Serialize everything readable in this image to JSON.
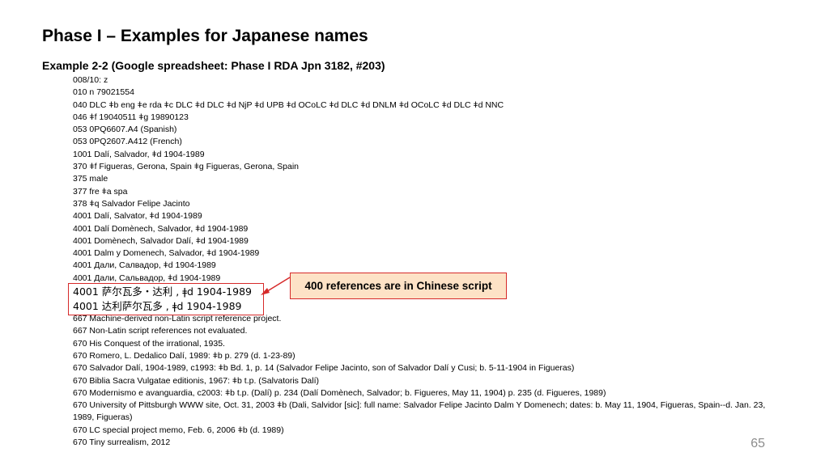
{
  "slide": {
    "title": "Phase I – Examples for Japanese names",
    "subtitle": "Example 2-2 (Google spreadsheet: Phase I RDA Jpn 3182, #203)",
    "page_number": "65"
  },
  "record": {
    "lines": [
      "008/10: z",
      "010  n  79021554",
      "040  DLC ǂb eng ǂe rda ǂc DLC ǂd DLC ǂd NjP ǂd UPB ǂd OCoLC ǂd DLC ǂd DNLM ǂd OCoLC ǂd DLC ǂd NNC",
      "046  ǂf 19040511 ǂg 19890123",
      "053 0PQ6607.A4 (Spanish)",
      "053 0PQ2607.A412 (French)",
      "1001 Dalí, Salvador, ǂd 1904-1989",
      "370  ǂf Figueras, Gerona, Spain ǂg Figueras, Gerona, Spain",
      "375  male",
      "377  fre ǂa spa",
      "378  ǂq Salvador Felipe Jacinto",
      "4001 Dalí, Salvator, ǂd 1904-1989",
      "4001 Dalí Domènech, Salvador, ǂd 1904-1989",
      "4001 Domènech, Salvador Dalí, ǂd 1904-1989",
      "4001 Dalm y Domenech, Salvador, ǂd 1904-1989",
      "4001 Дали, Салвадор, ǂd 1904-1989",
      "4001 Дали, Сальвадор, ǂd 1904-1989"
    ],
    "highlighted_lines": [
      "4001  萨尔瓦多・达利 , ǂd 1904-1989",
      "4001  达利萨尔瓦多 , ǂd 1904-1989"
    ],
    "lines_after": [
      "667  Machine-derived non-Latin script reference project.",
      "667  Non-Latin script references not evaluated.",
      "670  His Conquest of the irrational, 1935.",
      "670  Romero, L. Dedalico Dalí, 1989: ǂb p. 279 (d. 1-23-89)",
      "670  Salvador Dalí, 1904-1989, c1993: ǂb Bd. 1, p. 14 (Salvador Felipe Jacinto, son of Salvador Dalí y Cusi; b. 5-11-1904 in Figueras)",
      "670  Biblia Sacra Vulgatae editionis, 1967: ǂb t.p. (Salvatoris Dalí)",
      "670  Modernismo e avanguardia, c2003: ǂb t.p. (Dalí) p. 234 (Dalí Domènech, Salvador; b. Figueres, May 11, 1904) p. 235 (d. Figueres, 1989)",
      "670  University of Pittsburgh WWW site, Oct. 31, 2003 ǂb (Dali, Salvidor [sic]: full name: Salvador Felipe Jacinto Dalm Y Domenech; dates: b. May 11, 1904, Figueras, Spain--d. Jan. 23, 1989, Figueras)",
      "670  LC special project memo, Feb. 6, 2006 ǂb (d. 1989)",
      "670  Tiny surrealism, 2012"
    ]
  },
  "callout": {
    "text": "400 references are in Chinese script",
    "border_color": "#d62a2a",
    "fill_color": "#fde2c6"
  }
}
